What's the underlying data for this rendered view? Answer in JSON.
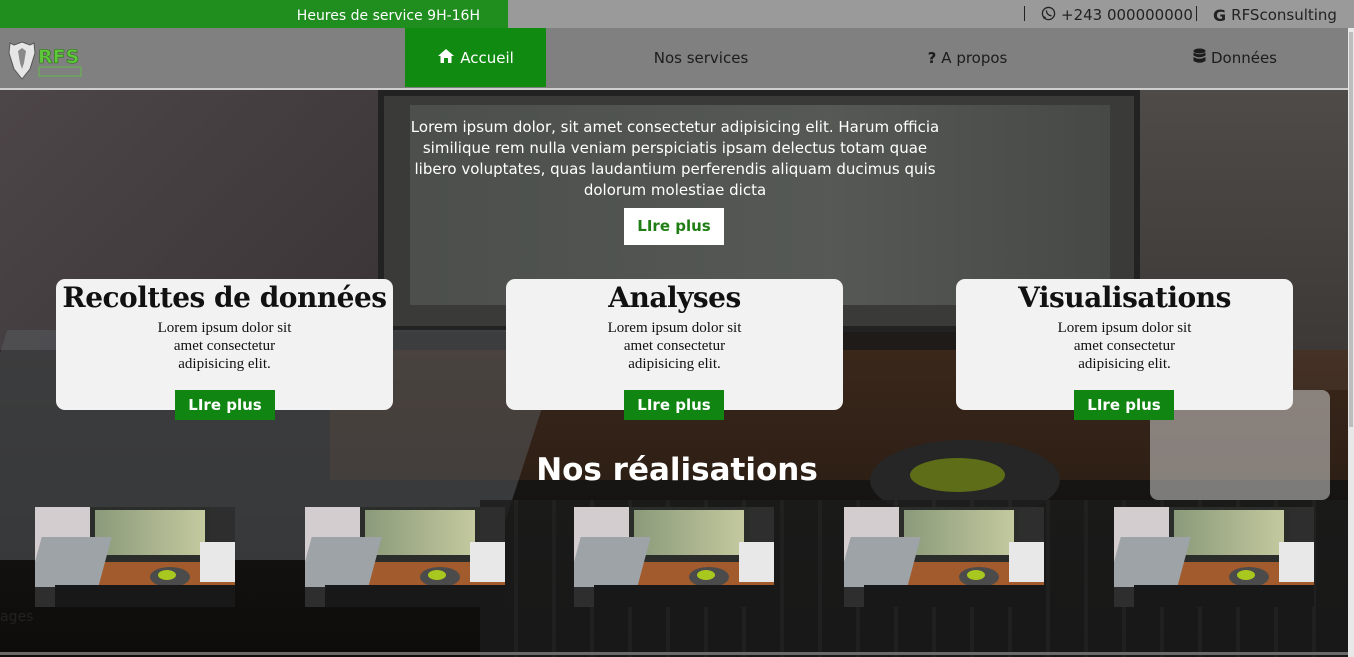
{
  "topbar": {
    "hours_text": "Heures de service 9H-16H",
    "phone_icon": "whatsapp-icon",
    "phone": "+243 000000000",
    "brand_icon": "google-icon",
    "brand": "RFSconsulting",
    "accent_color": "#1f8e1f"
  },
  "navbar": {
    "logo_text": "RFS",
    "items": [
      {
        "label": "Accueil",
        "icon": "home-icon",
        "active": true
      },
      {
        "label": "Nos services",
        "icon": "",
        "active": false
      },
      {
        "label": "A propos",
        "icon": "question-icon",
        "active": false
      },
      {
        "label": "Données",
        "icon": "database-icon",
        "active": false
      }
    ]
  },
  "hero": {
    "text": "Lorem ipsum dolor, sit amet consectetur adipisicing elit. Harum officia similique rem nulla veniam perspiciatis ipsam delectus totam quae libero voluptates, quas laudantium perferendis aliquam ducimus quis dolorum molestiae dicta",
    "button_label": "LIre plus"
  },
  "cards": [
    {
      "title": "Recolttes de données",
      "text": "Lorem ipsum dolor sit amet consectetur adipisicing elit.",
      "button_label": "LIre plus"
    },
    {
      "title": "Analyses",
      "text": "Lorem ipsum dolor sit amet consectetur adipisicing elit.",
      "button_label": "LIre plus"
    },
    {
      "title": "Visualisations",
      "text": "Lorem ipsum dolor sit amet consectetur adipisicing elit.",
      "button_label": "LIre plus"
    }
  ],
  "realisations": {
    "title": "Nos réalisations",
    "count": 5
  },
  "footer": {
    "pages_label": "ages"
  }
}
